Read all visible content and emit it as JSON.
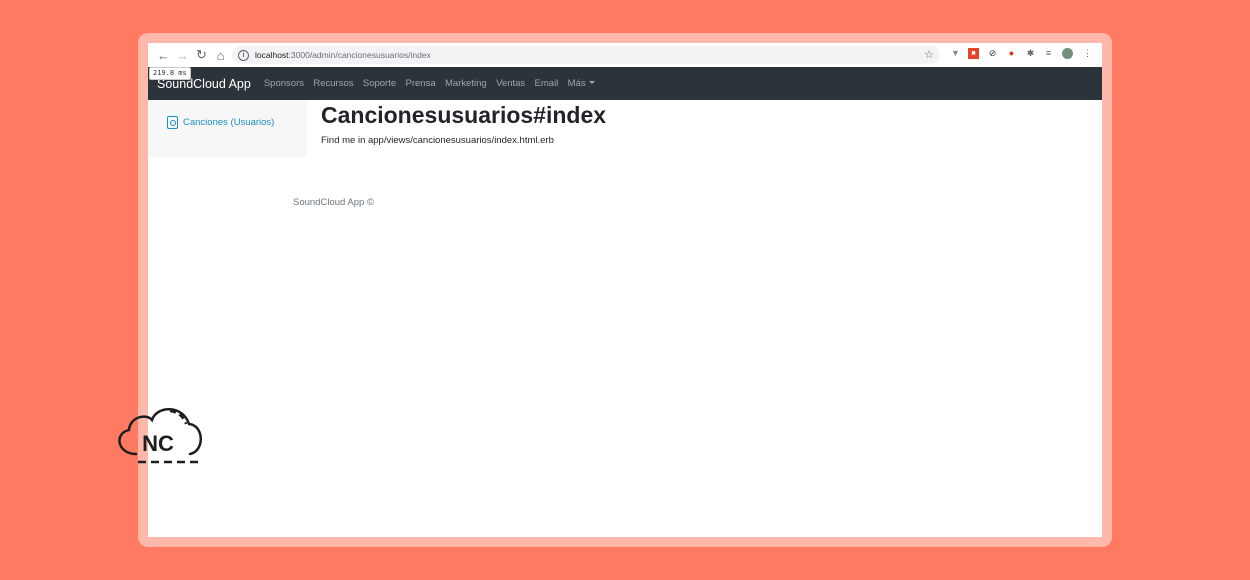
{
  "browser": {
    "url_host": "localhost",
    "url_path": ":3000/admin/cancionesusuarios/index",
    "timing_badge": "219.8 ms"
  },
  "navbar": {
    "brand": "SoundCloud App",
    "links": [
      "Sponsors",
      "Recursos",
      "Soporte",
      "Prensa",
      "Marketing",
      "Ventas",
      "Email"
    ],
    "dropdown_label": "Más"
  },
  "sidebar": {
    "items": [
      {
        "label": "Canciones (Usuarios)",
        "icon": "speaker-icon"
      }
    ]
  },
  "main": {
    "title": "Cancionesusuarios#index",
    "description": "Find me in app/views/cancionesusuarios/index.html.erb"
  },
  "footer": {
    "text": "SoundCloud App ©"
  },
  "logo": {
    "text": "NC"
  },
  "colors": {
    "background": "#ff7a63",
    "frame": "#ffb8aa",
    "navbar": "#2c343b",
    "link": "#1a8ec7"
  }
}
